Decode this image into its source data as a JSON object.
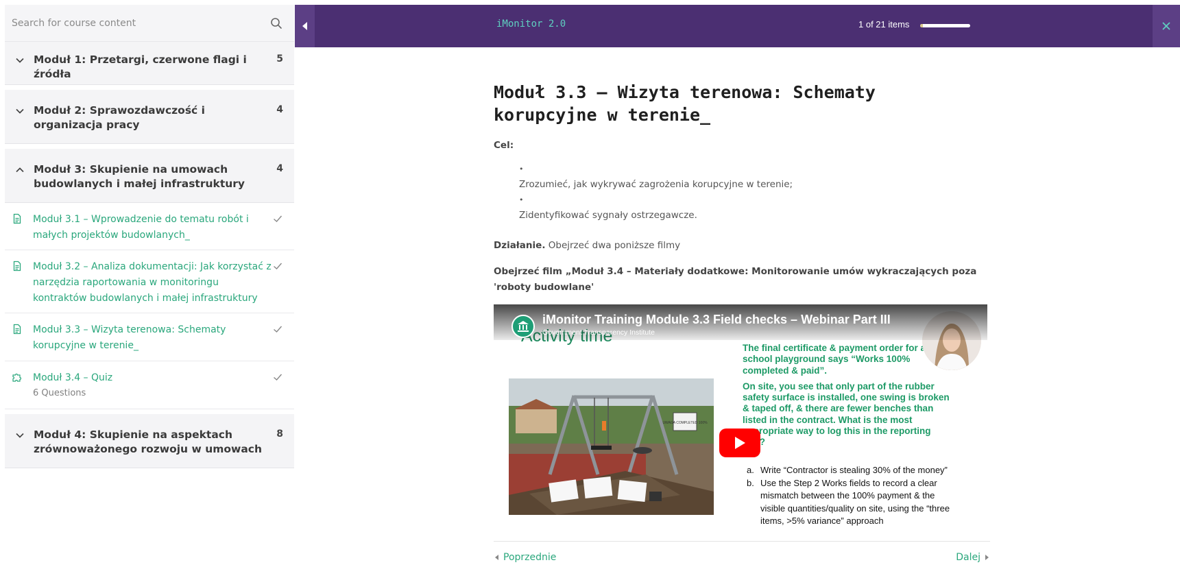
{
  "sidebar": {
    "search": {
      "placeholder": "Search for course content"
    },
    "modules": [
      {
        "title": "Moduł 1: Przetargi, czerwone flagi i źródła",
        "count": "5",
        "expanded": false
      },
      {
        "title": "Moduł 2: Sprawozdawczość i organizacja pracy",
        "count": "4",
        "expanded": false
      },
      {
        "title": "Moduł 3: Skupienie na umowach budowlanych i małej infrastruktury",
        "count": "4",
        "expanded": true,
        "lessons": [
          {
            "title": "Moduł 3.1 – Wprowadzenie do tematu robót i małych projektów budowlanych_",
            "icon": "document-icon",
            "completed": true
          },
          {
            "title": "Moduł 3.2 – Analiza dokumentacji: Jak korzystać z narzędzia raportowania w monitoringu kontraktów budowlanych i małej infrastruktury",
            "icon": "document-icon",
            "completed": true
          },
          {
            "title": "Moduł 3.3 – Wizyta terenowa: Schematy korupcyjne w terenie_",
            "icon": "document-icon",
            "completed": true
          },
          {
            "title": "Moduł 3.4 – Quiz",
            "subtitle": "6 Questions",
            "icon": "puzzle-icon",
            "completed": true
          }
        ]
      },
      {
        "title": "Moduł 4: Skupienie na aspektach zrównoważonego rozwoju w umowach",
        "count": "8",
        "expanded": false
      }
    ]
  },
  "topbar": {
    "app_title": "iMonitor 2.0",
    "progress_text": "1 of 21 items",
    "progress_fraction": 0.048,
    "accent_color": "#4b2f72",
    "teal_color": "#5fd0c0"
  },
  "content": {
    "title": "Moduł 3.3 – Wizyta terenowa: Schematy korupcyjne w terenie_",
    "cel_label": "Cel:",
    "bullet": "•",
    "goals": [
      "Zrozumieć, jak wykrywać zagrożenia korupcyjne w terenie;",
      "Zidentyfikować sygnały ostrzegawcze."
    ],
    "action_label": "Działanie.",
    "action_text": " Obejrzeć dwa poniższe filmy",
    "film_link": "Obejrzeć film „Moduł 3.4 – Materiały dodatkowe: Monitorowanie umów wykraczających poza 'roboty budowlane'"
  },
  "video": {
    "title": "iMonitor Training Module 3.3 Field checks – Webinar Part III",
    "channel": "Government Transparency Institute",
    "slide_heading": "Activity time",
    "slide_paragraph_1": "The final certificate & payment order for a school playground says “Works 100% completed & paid”.",
    "slide_paragraph_2": "On site, you see that only part of the rubber safety surface is installed, one swing is broken & taped off, & there are fewer benches than listed in the contract. What is the most appropriate way to log this in the reporting tool?",
    "answers": [
      {
        "letter": "a.",
        "text": "Write “Contractor is stealing 30% of the money”"
      },
      {
        "letter": "b.",
        "text": "Use the Step 2 Works fields to record a clear mismatch between the 100% payment & the visible quantities/quality on site, using the “three items, >5% variance” approach"
      }
    ],
    "sign_text": "UWAGA COMPLETED 100%"
  },
  "nav": {
    "prev_label": "Poprzednie",
    "next_label": "Dalej"
  }
}
